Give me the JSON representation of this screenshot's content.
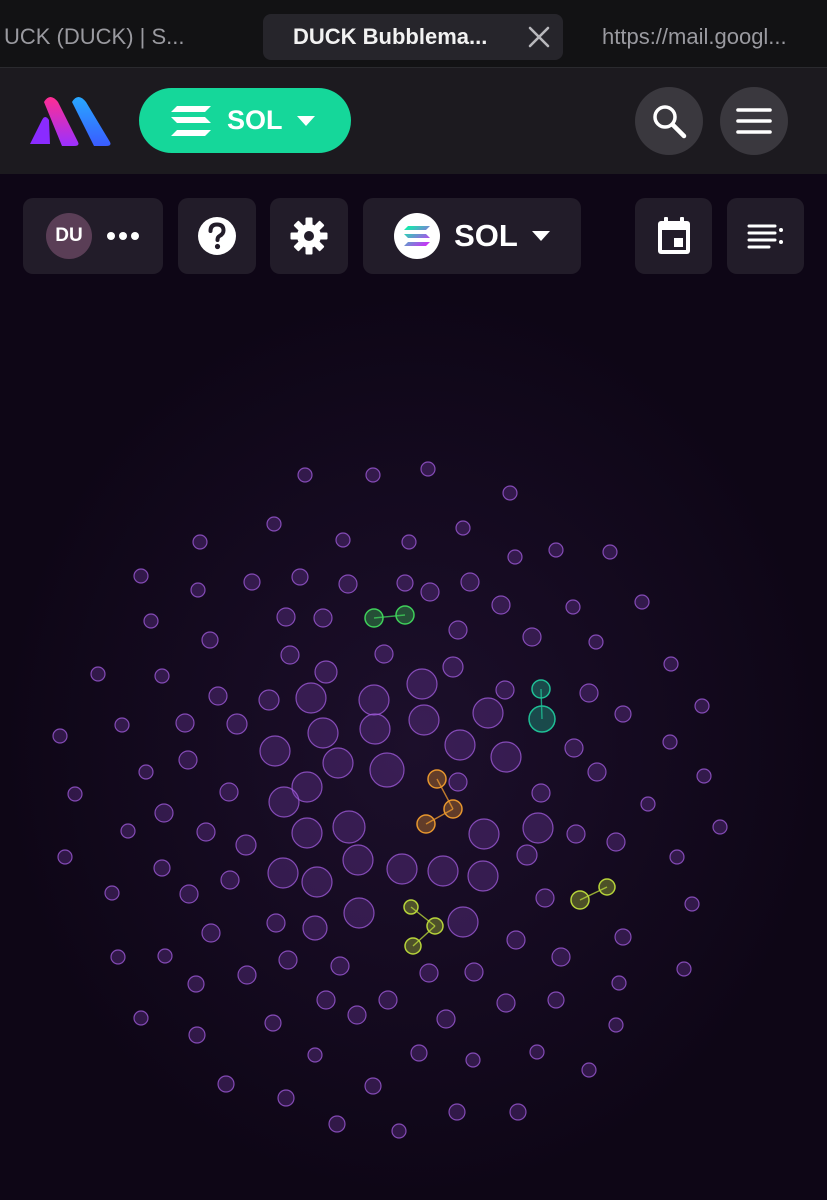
{
  "browser": {
    "tabs": [
      {
        "title": "UCK (DUCK) | S..."
      },
      {
        "title": "DUCK Bubblema..."
      },
      {
        "title": "https://mail.googl..."
      }
    ]
  },
  "header": {
    "chain_label": "SOL"
  },
  "toolbar": {
    "avatar_initials": "DU",
    "chain_label": "SOL"
  },
  "colors": {
    "accent": "#15d79a",
    "bubble": "#7a3fae",
    "cluster_green": "#3fcf5a",
    "cluster_teal": "#1fbf96",
    "cluster_orange": "#e7962e",
    "cluster_lime": "#b7d43a"
  },
  "icons": [
    "logo-icon",
    "solana-icon",
    "caret-down-icon",
    "search-icon",
    "menu-icon",
    "more-icon",
    "help-icon",
    "gear-icon",
    "calendar-icon",
    "list-icon",
    "close-icon"
  ]
}
